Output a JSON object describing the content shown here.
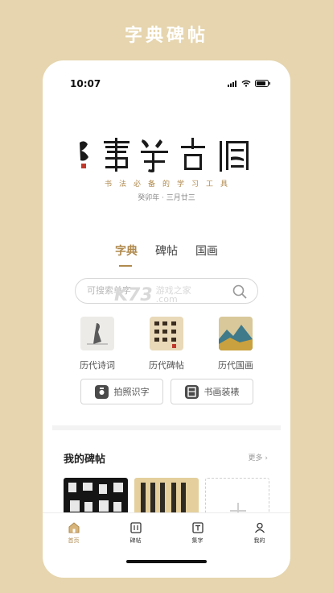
{
  "banner": {
    "title": "字典碑帖"
  },
  "status_bar": {
    "time": "10:07"
  },
  "header": {
    "subtitle": "书法必备的学习工具",
    "date": "癸卯年 · 三月廿三"
  },
  "tabs": [
    {
      "label": "字典",
      "active": true
    },
    {
      "label": "碑帖",
      "active": false
    },
    {
      "label": "国画",
      "active": false
    }
  ],
  "search": {
    "placeholder": "可搜索单字"
  },
  "watermark": {
    "logo": "K73",
    "line1": "游戏之家",
    "line2": ".com"
  },
  "categories": [
    {
      "label": "历代诗词",
      "icon": "poetry-painting-icon"
    },
    {
      "label": "历代碑帖",
      "icon": "rubbing-scroll-icon"
    },
    {
      "label": "历代国画",
      "icon": "landscape-painting-icon"
    }
  ],
  "actions": {
    "photo_recognize": "拍照识字",
    "mounting": "书画装裱"
  },
  "my_rubbings": {
    "title": "我的碑帖",
    "more": "更多 ›"
  },
  "bottom_nav": [
    {
      "label": "首页",
      "icon": "home-icon",
      "active": true
    },
    {
      "label": "碑帖",
      "icon": "rubbing-icon",
      "active": false
    },
    {
      "label": "集字",
      "icon": "collect-char-icon",
      "active": false
    },
    {
      "label": "我的",
      "icon": "profile-icon",
      "active": false
    }
  ],
  "colors": {
    "accent": "#b08a4e",
    "background": "#e6d5ae"
  }
}
